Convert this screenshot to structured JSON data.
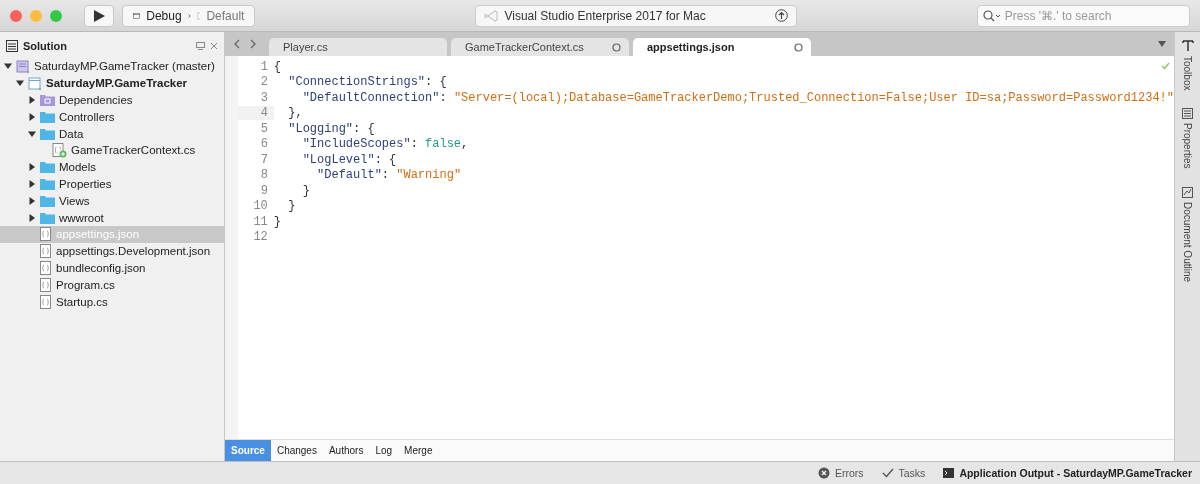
{
  "window": {
    "run_config": "Debug",
    "device": "Default",
    "title": "Visual Studio Enterprise 2017 for Mac",
    "search": {
      "placeholder": "Press '⌘.' to search"
    }
  },
  "sidebar": {
    "title": "Solution",
    "items": [
      {
        "label": "SaturdayMP.GameTracker (master)",
        "kind": "solution",
        "selected": false,
        "expanded": true,
        "children": [
          {
            "label": "SaturdayMP.GameTracker",
            "kind": "project",
            "selected": false,
            "expanded": true,
            "children": [
              {
                "label": "Dependencies",
                "kind": "dependencies",
                "selected": false,
                "expanded": false
              },
              {
                "label": "Controllers",
                "kind": "folder",
                "selected": false,
                "expanded": false
              },
              {
                "label": "Data",
                "kind": "folder",
                "selected": false,
                "expanded": true,
                "children": [
                  {
                    "label": "GameTrackerContext.cs",
                    "kind": "newfile",
                    "selected": false
                  }
                ]
              },
              {
                "label": "Models",
                "kind": "folder",
                "selected": false,
                "expanded": false
              },
              {
                "label": "Properties",
                "kind": "folder",
                "selected": false,
                "expanded": false
              },
              {
                "label": "Views",
                "kind": "folder",
                "selected": false,
                "expanded": false
              },
              {
                "label": "wwwroot",
                "kind": "folder",
                "selected": false,
                "expanded": false
              },
              {
                "label": "appsettings.json",
                "kind": "file",
                "selected": true
              },
              {
                "label": "appsettings.Development.json",
                "kind": "file",
                "selected": false
              },
              {
                "label": "bundleconfig.json",
                "kind": "file",
                "selected": false
              },
              {
                "label": "Program.cs",
                "kind": "file",
                "selected": false
              },
              {
                "label": "Startup.cs",
                "kind": "file",
                "selected": false
              }
            ]
          }
        ]
      }
    ]
  },
  "tabs": [
    {
      "label": "Player.cs",
      "selected": false,
      "modified": false
    },
    {
      "label": "GameTrackerContext.cs",
      "selected": false,
      "modified": true
    },
    {
      "label": "appsettings.json",
      "selected": true,
      "modified": true
    }
  ],
  "editor": {
    "lines": [
      {
        "number": "1",
        "tokens": [
          {
            "kind": "punct",
            "text": "{"
          }
        ]
      },
      {
        "number": "2",
        "tokens": [
          {
            "kind": "key",
            "text": "  \"ConnectionStrings\""
          },
          {
            "kind": "punct",
            "text": ": {"
          }
        ]
      },
      {
        "number": "3",
        "tokens": [
          {
            "kind": "key",
            "text": "    \"DefaultConnection\""
          },
          {
            "kind": "punct",
            "text": ": "
          },
          {
            "kind": "string",
            "text": "\"Server=(local);Database=GameTrackerDemo;Trusted_Connection=False;User ID=sa;Password=Password1234!\""
          }
        ]
      },
      {
        "number": "4",
        "current": true,
        "tokens": [
          {
            "kind": "punct",
            "text": "  },"
          }
        ]
      },
      {
        "number": "5",
        "tokens": [
          {
            "kind": "key",
            "text": "  \"Logging\""
          },
          {
            "kind": "punct",
            "text": ": {"
          }
        ]
      },
      {
        "number": "6",
        "tokens": [
          {
            "kind": "key",
            "text": "    \"IncludeScopes\""
          },
          {
            "kind": "punct",
            "text": ": "
          },
          {
            "kind": "literal",
            "text": "false"
          },
          {
            "kind": "punct",
            "text": ","
          }
        ]
      },
      {
        "number": "7",
        "tokens": [
          {
            "kind": "key",
            "text": "    \"LogLevel\""
          },
          {
            "kind": "punct",
            "text": ": {"
          }
        ]
      },
      {
        "number": "8",
        "tokens": [
          {
            "kind": "key",
            "text": "      \"Default\""
          },
          {
            "kind": "punct",
            "text": ": "
          },
          {
            "kind": "string",
            "text": "\"Warning\""
          }
        ]
      },
      {
        "number": "9",
        "tokens": [
          {
            "kind": "punct",
            "text": "    }"
          }
        ]
      },
      {
        "number": "10",
        "tokens": [
          {
            "kind": "punct",
            "text": "  }"
          }
        ]
      },
      {
        "number": "11",
        "tokens": [
          {
            "kind": "punct",
            "text": "}"
          }
        ]
      },
      {
        "number": "12"
      }
    ]
  },
  "bottom_tabs": [
    {
      "label": "Source",
      "selected": true
    },
    {
      "label": "Changes",
      "selected": false
    },
    {
      "label": "Authors",
      "selected": false
    },
    {
      "label": "Log",
      "selected": false
    },
    {
      "label": "Merge",
      "selected": false
    }
  ],
  "side_pads": [
    {
      "label": "Toolbox",
      "kind": "toolbox"
    },
    {
      "label": "Properties",
      "kind": "properties"
    },
    {
      "label": "Document Outline",
      "kind": "outline"
    }
  ],
  "status_bar": {
    "errors": "Errors",
    "tasks": "Tasks",
    "output": "Application Output - SaturdayMP.GameTracker"
  }
}
